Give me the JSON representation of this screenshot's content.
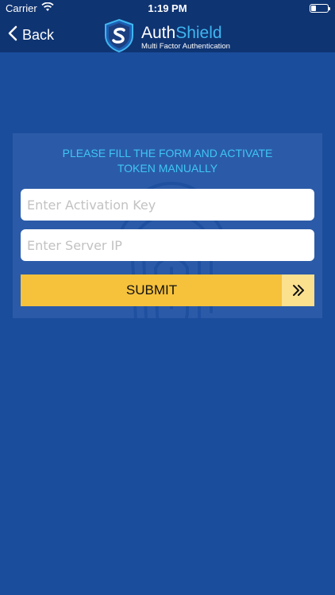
{
  "status_bar": {
    "carrier": "Carrier",
    "time": "1:19 PM",
    "icons": [
      "wifi-icon",
      "battery-icon"
    ]
  },
  "nav": {
    "back_label": "Back",
    "logo": {
      "title_part1": "Auth",
      "title_part2": "Shield",
      "subtitle": "Multi Factor Authentication"
    }
  },
  "form": {
    "title_line1": "PLEASE FILL THE FORM AND ACTIVATE",
    "title_line2": "TOKEN MANUALLY",
    "activation_key": {
      "value": "",
      "placeholder": "Enter Activation Key"
    },
    "server_ip": {
      "value": "",
      "placeholder": "Enter Server IP"
    },
    "submit_label": "SUBMIT",
    "submit_icon": "double-chevron-right-icon"
  },
  "colors": {
    "background": "#1a4d9c",
    "nav_background": "#0f3472",
    "card_background": "#2b5ba8",
    "title_accent": "#3fc6f5",
    "logo_accent": "#3fb6f0",
    "submit_button": "#f6c23c",
    "submit_arrow_bg": "#fbe08e"
  }
}
